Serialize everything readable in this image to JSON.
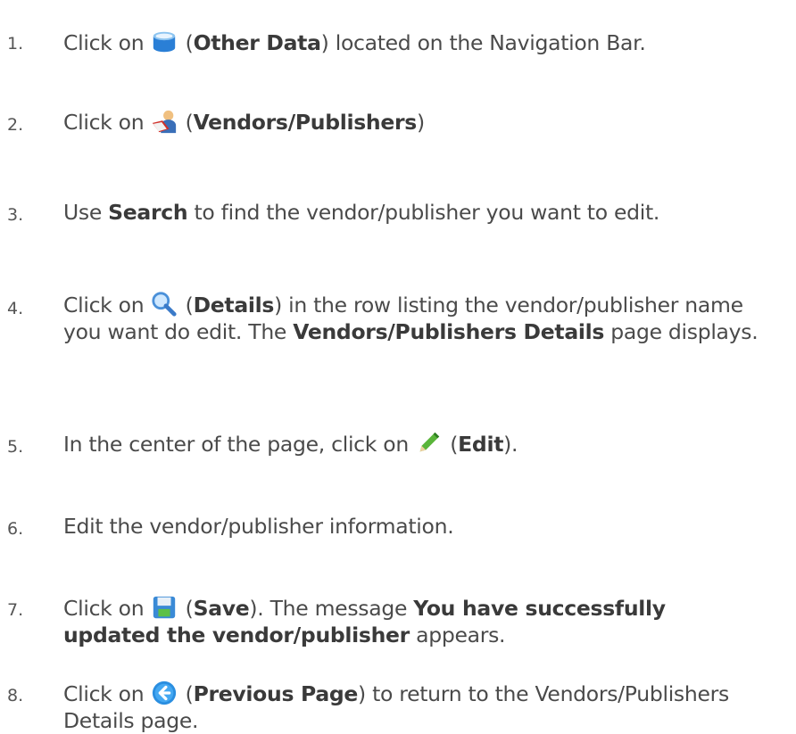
{
  "steps": [
    {
      "num": "1.",
      "pre": "Click on ",
      "icon": "other-data-icon",
      "open": " (",
      "bold1": "Other Data",
      "post1": ") located on the Navigation Bar."
    },
    {
      "num": "2.",
      "pre": "Click on ",
      "icon": "vendors-publishers-icon",
      "open": " (",
      "bold1": "Vendors/Publishers",
      "post1": ")"
    },
    {
      "num": "3.",
      "pre": "Use ",
      "bold1": "Search",
      "post1": " to find the vendor/publisher you want to edit."
    },
    {
      "num": "4.",
      "pre": "Click on ",
      "icon": "details-magnifier-icon",
      "open": " (",
      "bold1": "Details",
      "post1": ") in the row listing the vendor/publisher name you want do edit. The ",
      "bold2": "Vendors/Publishers Details",
      "post2": " page displays."
    },
    {
      "num": "5.",
      "pre": "In the center of the page, click on ",
      "icon": "edit-pencil-icon",
      "open": " (",
      "bold1": "Edit",
      "post1": ")."
    },
    {
      "num": "6.",
      "pre": "Edit the vendor/publisher information."
    },
    {
      "num": "7.",
      "pre": "Click on ",
      "icon": "save-disk-icon",
      "open": " (",
      "bold1": "Save",
      "post1": ").  The message ",
      "bold2": "You have successfully updated the vendor/publisher",
      "post2": " appears."
    },
    {
      "num": "8.",
      "pre": "Click on ",
      "icon": "previous-page-icon",
      "open": " (",
      "bold1": "Previous Page",
      "post1": ") to return to the Vendors/Publishers Details page."
    }
  ],
  "colors": {
    "text": "#4a4a4a",
    "bold": "#3a3a3a",
    "icon_blue": "#2a7fd6",
    "icon_green": "#3aa63a"
  }
}
